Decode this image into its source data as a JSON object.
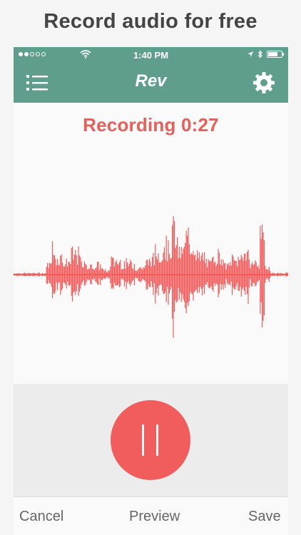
{
  "caption": "Record audio for free",
  "status_bar": {
    "time": "1:40 PM",
    "signal_dots_filled": 2,
    "signal_dots_total": 5
  },
  "nav": {
    "logo_text": "Rev",
    "menu_icon": "list-menu-icon",
    "settings_icon": "gear-icon"
  },
  "recording": {
    "title": "Recording 0:27",
    "elapsed": "0:27"
  },
  "controls": {
    "pause_icon": "pause-icon"
  },
  "bottom_bar": {
    "cancel_label": "Cancel",
    "preview_label": "Preview",
    "save_label": "Save"
  },
  "colors": {
    "header": "#5f9e8c",
    "accent": "#f15c5c",
    "recording_text": "#e5605a",
    "bottom_text": "#666666"
  }
}
